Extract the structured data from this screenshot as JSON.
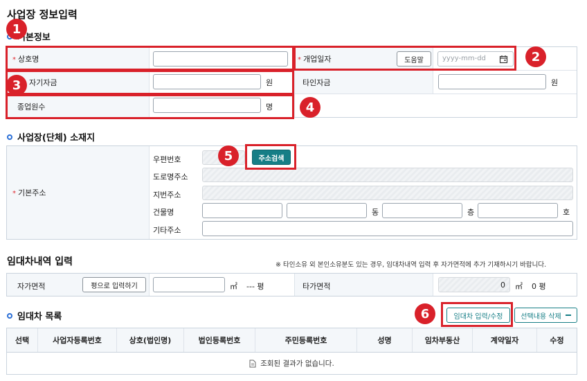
{
  "page_title": "사업장 정보입력",
  "basic": {
    "section_title": "기본정보",
    "company_name_label": "상호명",
    "company_name_value": "",
    "open_date_label": "개업일자",
    "help_button": "도움말",
    "open_date_placeholder": "yyyy-mm-dd",
    "own_capital_label": "자기자금",
    "own_capital_unit": "원",
    "other_capital_label": "타인자금",
    "other_capital_unit": "원",
    "employees_label": "종업원수",
    "employees_unit": "명"
  },
  "location": {
    "section_title": "사업장(단체) 소재지",
    "basic_address_label": "기본주소",
    "postal_label": "우편번호",
    "address_search_button": "주소검색",
    "road_address_label": "도로명주소",
    "lot_address_label": "지번주소",
    "building_label": "건물명",
    "dong_unit": "동",
    "floor_unit": "층",
    "room_unit": "호",
    "other_address_label": "기타주소"
  },
  "lease": {
    "section_title": "임대차내역 입력",
    "note": "※ 타인소유 외 본인소유분도 있는 경우, 임대차내역 입력 후 자가면적에 추가 기재하시기 바랍니다.",
    "own_area_label": "자가면적",
    "pyeong_input_button": "평으로 입력하기",
    "sqm_unit": "㎡",
    "own_pyeong_text": "--- 평",
    "other_area_label": "타가면적",
    "other_area_value": "0",
    "other_pyeong_text": "0 평"
  },
  "lease_list": {
    "section_title": "임대차 목록",
    "edit_button": "임대차 입력/수정",
    "delete_button": "선택내용 삭제",
    "delete_icon": "minus-icon",
    "columns": [
      "선택",
      "사업자등록번호",
      "상호(법인명)",
      "법인등록번호",
      "주민등록번호",
      "성명",
      "임차부동산",
      "계약일자",
      "수정"
    ],
    "empty_message": "조회된 결과가 없습니다.",
    "empty_icon": "document-icon"
  },
  "annotations": [
    "1",
    "2",
    "3",
    "4",
    "5",
    "6"
  ],
  "colors": {
    "accent": "#167e86",
    "marker": "#d9212a",
    "section_dot": "#2b6fd6"
  }
}
